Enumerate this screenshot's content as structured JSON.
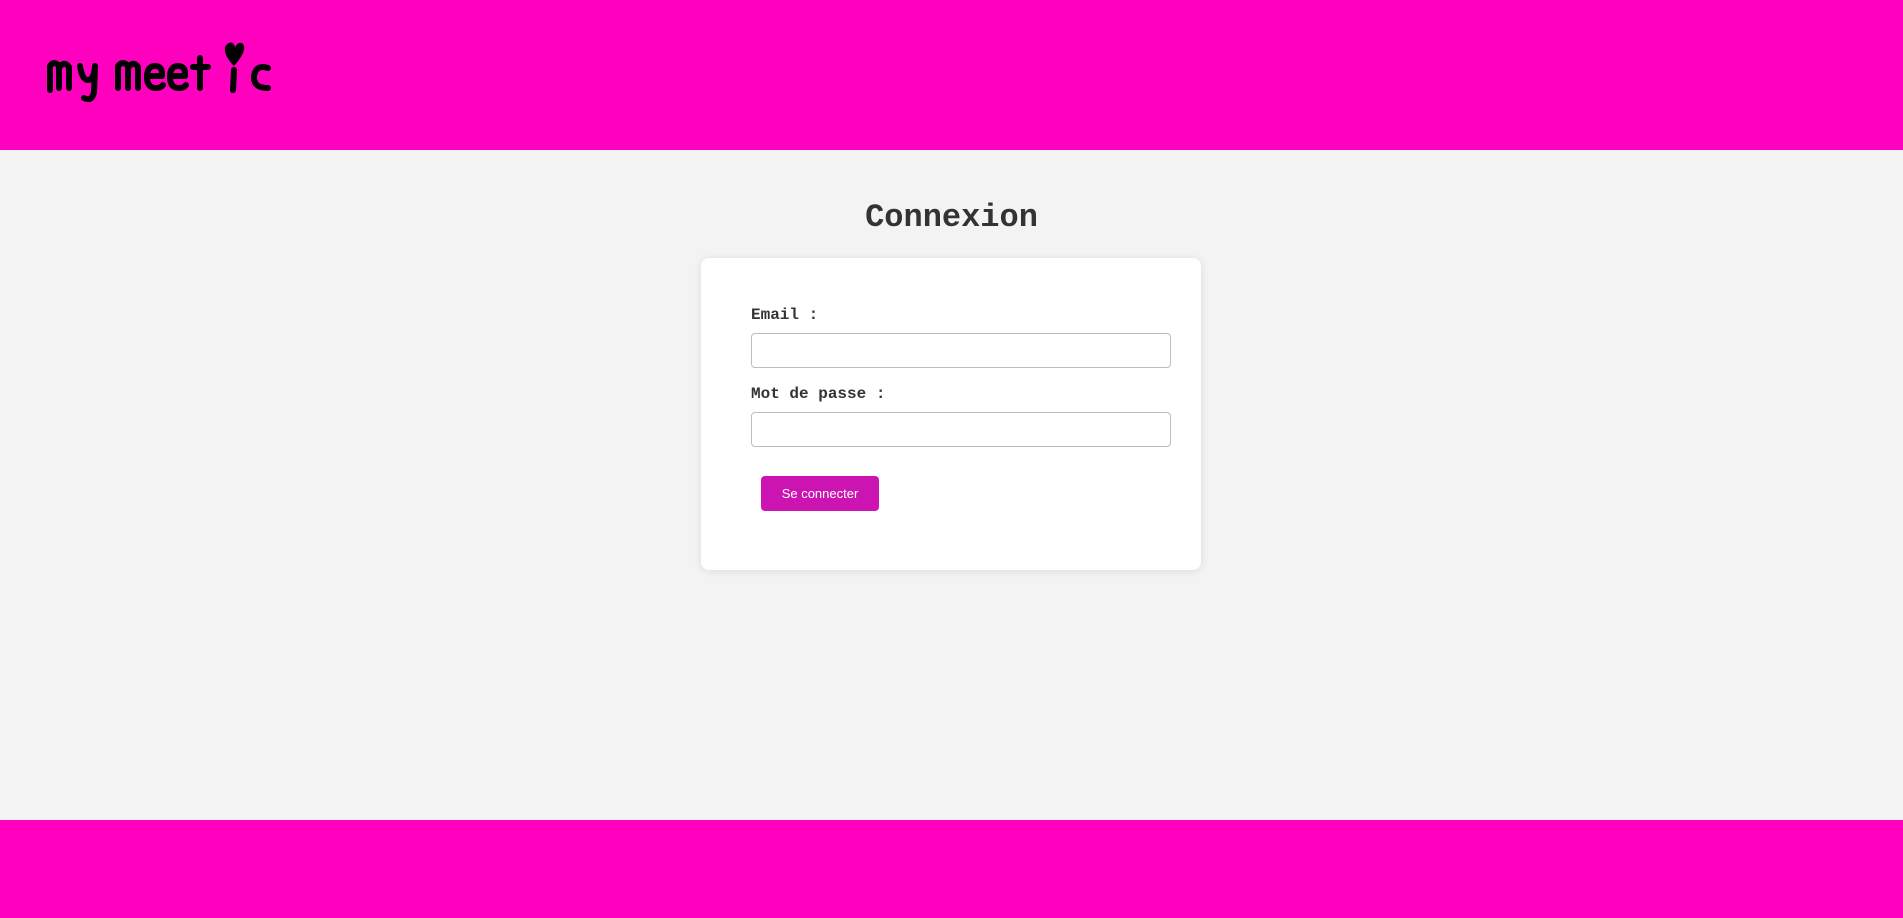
{
  "header": {
    "logo_text": "my meetic",
    "background_color": "#ff00bf"
  },
  "main": {
    "title": "Connexion",
    "form": {
      "email_label": "Email :",
      "email_value": "",
      "password_label": "Mot de passe :",
      "password_value": "",
      "submit_label": "Se connecter",
      "submit_color": "#cc14b3"
    }
  },
  "footer": {
    "background_color": "#ff00bf"
  }
}
